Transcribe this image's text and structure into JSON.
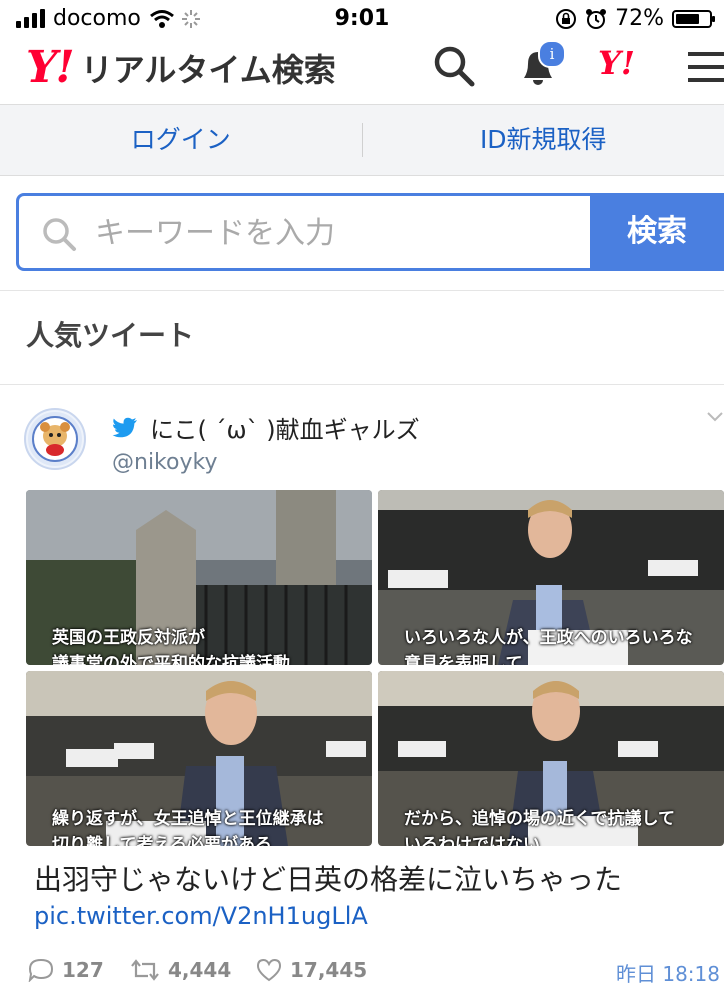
{
  "status": {
    "carrier": "docomo",
    "time": "9:01",
    "battery": "72%",
    "battery_level": 0.72
  },
  "header": {
    "logo_text": "Y!",
    "service_name": "リアルタイム検索",
    "notification_count": "i",
    "yahoo_small_logo": "Y!"
  },
  "login": {
    "login_label": "ログイン",
    "register_label": "ID新規取得"
  },
  "search": {
    "placeholder": "キーワードを入力",
    "value": "",
    "button_label": "検索"
  },
  "section": {
    "title": "人気ツイート"
  },
  "tweet": {
    "name": "にこ( ´ω` )献血ギャルズ",
    "handle": "@nikoyky",
    "images": [
      {
        "caption_line1": "英国の王政反対派が",
        "caption_line2": "議事堂の外で平和的な抗議活動"
      },
      {
        "caption_line1": "いろいろな人が、王政へのいろいろな",
        "caption_line2": "意見を表明して"
      },
      {
        "caption_line1": "繰り返すが、女王追悼と王位継承は",
        "caption_line2": "切り離して考える必要がある"
      },
      {
        "caption_line1": "だから、追悼の場の近くで抗議して",
        "caption_line2": "いるわけではない"
      }
    ],
    "text": "出羽守じゃないけど日英の格差に泣いちゃった",
    "link": "pic.twitter.com/V2nH1ugLlA",
    "replies": "127",
    "retweets": "4,444",
    "likes": "17,445",
    "date": "昨日 18:18"
  },
  "colors": {
    "accent": "#4a7fe0",
    "brand_red": "#ff0033",
    "link": "#1b61c4"
  },
  "icons": [
    "wifi-icon",
    "alarm-icon",
    "search-icon",
    "bell-icon",
    "menu-icon",
    "twitter-bird-icon",
    "reply-icon",
    "retweet-icon",
    "like-icon",
    "chevron-down-icon"
  ]
}
